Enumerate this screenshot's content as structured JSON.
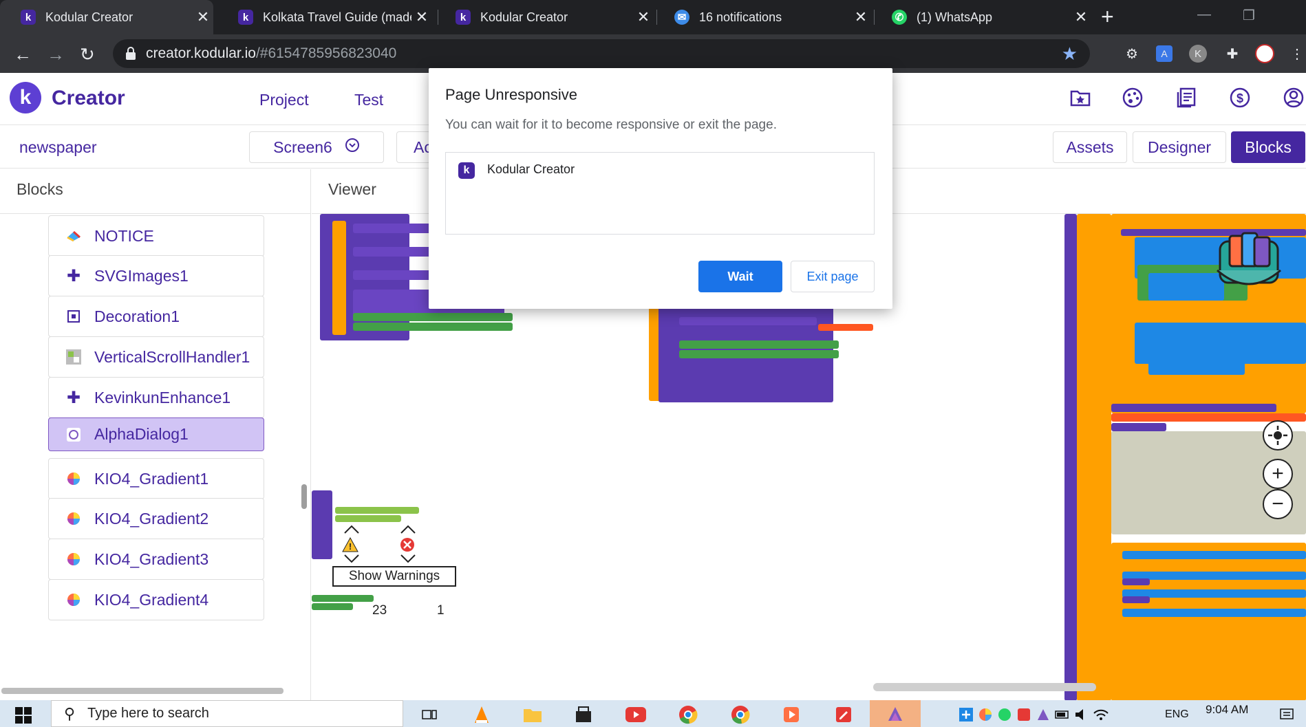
{
  "browser": {
    "tabs": [
      {
        "title": "Kodular Creator",
        "favicon": "kodular-icon",
        "active": true
      },
      {
        "title": "Kolkata Travel Guide (made",
        "favicon": "kodular-icon",
        "active": false
      },
      {
        "title": "Kodular Creator",
        "favicon": "kodular-icon",
        "active": false
      },
      {
        "title": "16 notifications",
        "favicon": "chat-icon",
        "active": false
      },
      {
        "title": "(1) WhatsApp",
        "favicon": "whatsapp-icon",
        "active": false
      }
    ],
    "url_host": "creator.kodular.io",
    "url_rest": "/#6154785956823040"
  },
  "app": {
    "brand": "Creator",
    "nav": {
      "project": "Project",
      "test": "Test"
    },
    "project_name": "newspaper",
    "screen": "Screen6",
    "add_screen": "Ac",
    "modes": {
      "assets": "Assets",
      "designer": "Designer",
      "blocks": "Blocks"
    }
  },
  "blocks_panel": {
    "title": "Blocks",
    "items": [
      {
        "label": "NOTICE",
        "icon": "notice-icon"
      },
      {
        "label": "SVGImages1",
        "icon": "puzzle-icon"
      },
      {
        "label": "Decoration1",
        "icon": "decoration-icon"
      },
      {
        "label": "VerticalScrollHandler1",
        "icon": "scroll-handler-icon"
      },
      {
        "label": "KevinkunEnhance1",
        "icon": "puzzle-icon"
      },
      {
        "label": "AlphaDialog1",
        "icon": "dialog-icon",
        "selected": true
      },
      {
        "label": "KIO4_Gradient1",
        "icon": "gradient-icon"
      },
      {
        "label": "KIO4_Gradient2",
        "icon": "gradient-icon"
      },
      {
        "label": "KIO4_Gradient3",
        "icon": "gradient-icon"
      },
      {
        "label": "KIO4_Gradient4",
        "icon": "gradient-icon"
      }
    ]
  },
  "viewer": {
    "title": "Viewer",
    "warnings": "23",
    "errors": "1",
    "show_warnings": "Show Warnings"
  },
  "dialog": {
    "title": "Page Unresponsive",
    "message": "You can wait for it to become responsive or exit the page.",
    "page_name": "Kodular Creator",
    "wait": "Wait",
    "exit": "Exit page"
  },
  "taskbar": {
    "search_placeholder": "Type here to search",
    "lang": "ENG",
    "time": "9:04 AM"
  },
  "colors": {
    "brand": "#4527a0",
    "block_purple": "#5b3bb0",
    "block_green": "#4caf50",
    "block_orange": "#ffa000",
    "wait_blue": "#1a73e8"
  }
}
